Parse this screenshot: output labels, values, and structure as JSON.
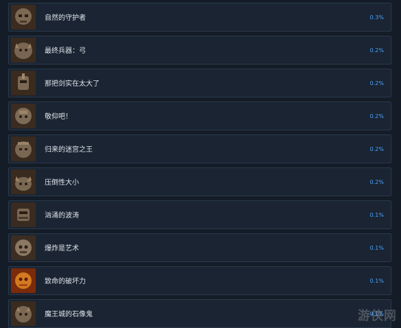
{
  "achievements": [
    {
      "title": "自然的守护者",
      "percent": "0.3%",
      "icon": "stone-guardian-icon",
      "tone": "#6b5a47"
    },
    {
      "title": "最终兵器：弓",
      "percent": "0.2%",
      "icon": "bow-weapon-icon",
      "tone": "#6a5946"
    },
    {
      "title": "那把剑实在太大了",
      "percent": "0.2%",
      "icon": "big-sword-icon",
      "tone": "#6f5b46"
    },
    {
      "title": "敬仰吧！",
      "percent": "0.2%",
      "icon": "worship-knight-icon",
      "tone": "#705f4b"
    },
    {
      "title": "归来的迷宫之王",
      "percent": "0.2%",
      "icon": "labyrinth-king-icon",
      "tone": "#6b5946"
    },
    {
      "title": "压倒性大小",
      "percent": "0.2%",
      "icon": "giant-beast-icon",
      "tone": "#6d5b47"
    },
    {
      "title": "汹涌的波涛",
      "percent": "0.1%",
      "icon": "surging-wave-icon",
      "tone": "#6a5a49"
    },
    {
      "title": "爆炸是艺术",
      "percent": "0.1%",
      "icon": "explosion-art-icon",
      "tone": "#6f604f"
    },
    {
      "title": "致命的破坏力",
      "percent": "0.1%",
      "icon": "deadly-destruction-icon",
      "tone": "#b6621e"
    },
    {
      "title": "魔王城的石像鬼",
      "percent": "0.1%",
      "icon": "gargoyle-icon",
      "tone": "#6a5846"
    }
  ],
  "watermark": "游侠网"
}
